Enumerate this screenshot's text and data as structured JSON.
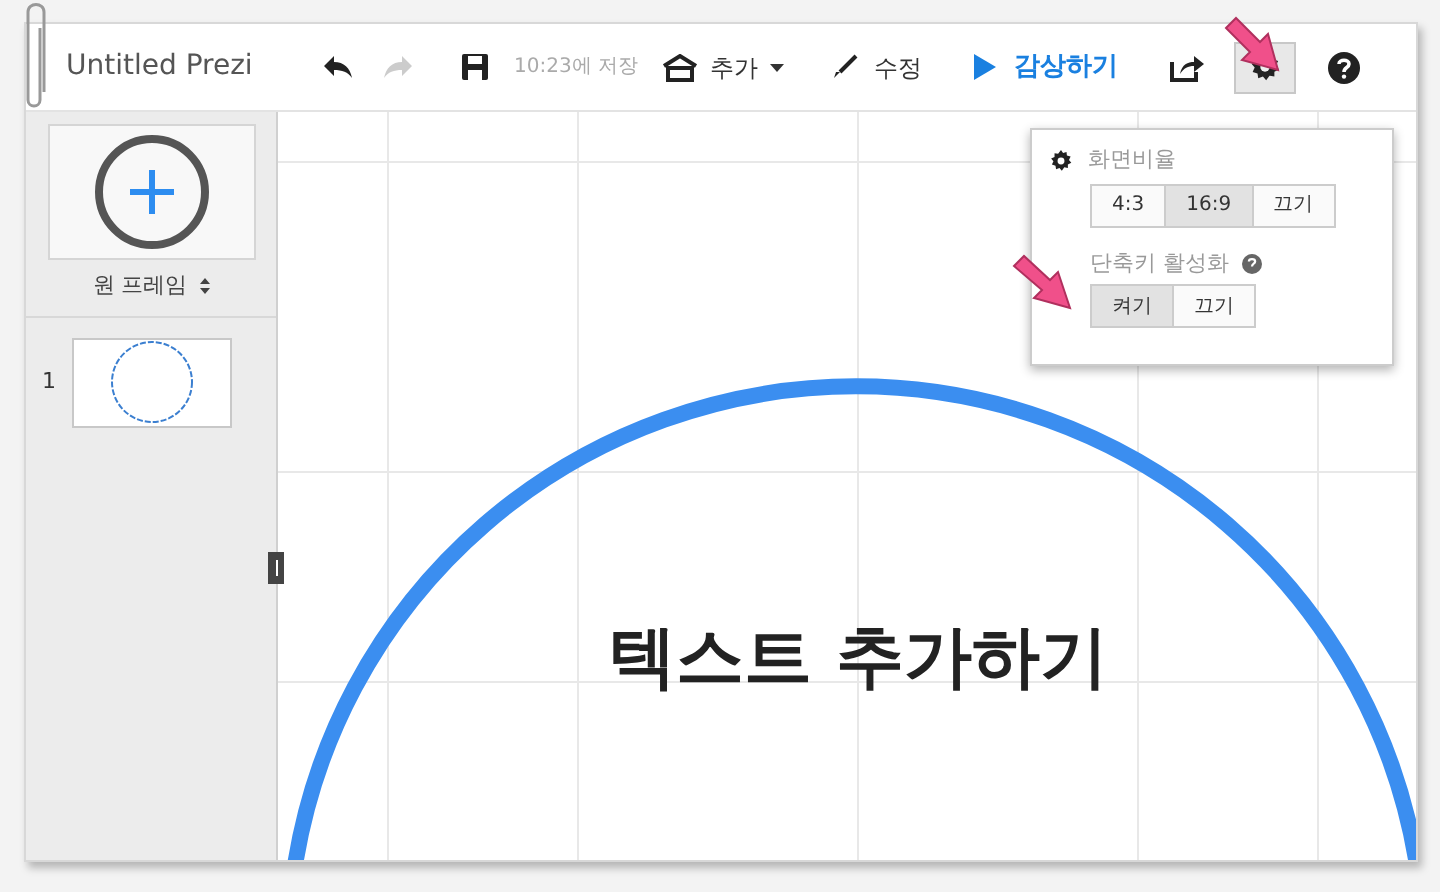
{
  "window": {
    "title": "Untitled Prezi"
  },
  "toolbar": {
    "save_status": "10:23에 저장",
    "add_label": "추가",
    "edit_label": "수정",
    "present_label": "감상하기",
    "settings_open": true
  },
  "sidebar": {
    "frame_type": "원 프레임",
    "slides": [
      {
        "number": "1",
        "selected": true
      }
    ]
  },
  "settings_popup": {
    "aspect": {
      "label": "화면비율",
      "options": [
        {
          "label": "4:3",
          "selected": false
        },
        {
          "label": "16:9",
          "selected": true
        },
        {
          "label": "끄기",
          "selected": false
        }
      ]
    },
    "shortcuts": {
      "label": "단축키 활성화",
      "options": [
        {
          "label": "켜기",
          "selected": true
        },
        {
          "label": "끄기",
          "selected": false
        }
      ]
    }
  },
  "canvas": {
    "text": "텍스트 추가하기"
  }
}
